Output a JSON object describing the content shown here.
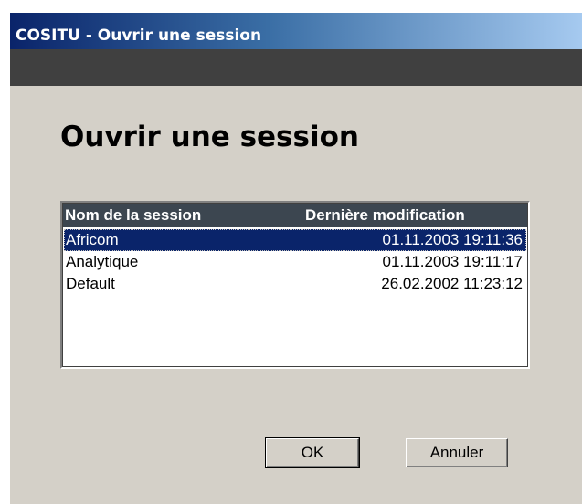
{
  "window": {
    "title": "COSITU - Ouvrir une session"
  },
  "dialog": {
    "heading": "Ouvrir une session"
  },
  "list": {
    "columns": [
      "Nom de la session",
      "Dernière modification"
    ],
    "rows": [
      {
        "name": "Africom",
        "modified": "01.11.2003 19:11:36",
        "selected": true
      },
      {
        "name": "Analytique",
        "modified": "01.11.2003 19:11:17",
        "selected": false
      },
      {
        "name": "Default",
        "modified": "26.02.2002 11:23:12",
        "selected": false
      }
    ]
  },
  "buttons": {
    "ok_label": "OK",
    "cancel_label": "Annuler"
  },
  "colors": {
    "titlebar_start": "#0a246a",
    "titlebar_end": "#a6caf0",
    "selection": "#0a246a",
    "dialog_bg": "#d4d0c8",
    "list_header_bg": "#3c4650"
  }
}
